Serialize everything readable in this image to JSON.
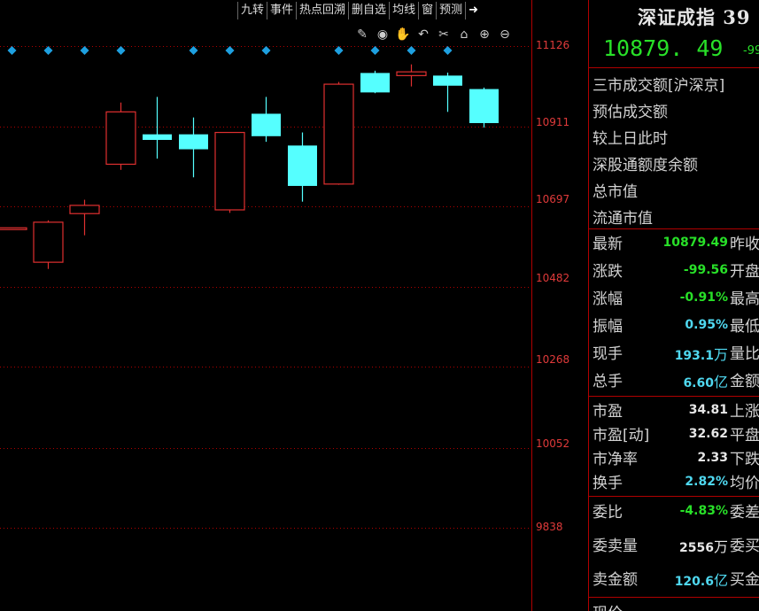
{
  "toolbar": {
    "items": [
      "九转",
      "事件",
      "热点回溯",
      "删自选",
      "均线",
      "窗",
      "预测"
    ],
    "pin_icon": "pin-right-icon"
  },
  "tools": [
    "pencil-icon",
    "eye-icon",
    "hand-icon",
    "undo-icon",
    "scissors-icon",
    "lock-icon",
    "zoom-in-icon",
    "zoom-out-icon"
  ],
  "colors": {
    "up": "#e03030",
    "down": "#55ffff",
    "marker": "#1ea0e0",
    "grid": "#b00000"
  },
  "price_axis": {
    "ticks": [
      "11126",
      "10911",
      "10697",
      "10482",
      "10268",
      "10052",
      "9838"
    ]
  },
  "chart_data": {
    "type": "candlestick",
    "ylim": [
      9838,
      11126
    ],
    "candles": [
      {
        "o": 10640,
        "c": 10640,
        "h": 10640,
        "l": 10640
      },
      {
        "o": 10548,
        "c": 10655,
        "h": 10660,
        "l": 10530
      },
      {
        "o": 10678,
        "c": 10700,
        "h": 10715,
        "l": 10620
      },
      {
        "o": 10810,
        "c": 10950,
        "h": 10975,
        "l": 10795
      },
      {
        "o": 10890,
        "c": 10875,
        "h": 10990,
        "l": 10825
      },
      {
        "o": 10890,
        "c": 10850,
        "h": 10935,
        "l": 10775
      },
      {
        "o": 10688,
        "c": 10895,
        "h": 10895,
        "l": 10680
      },
      {
        "o": 10945,
        "c": 10885,
        "h": 10990,
        "l": 10870
      },
      {
        "o": 10860,
        "c": 10752,
        "h": 10895,
        "l": 10710
      },
      {
        "o": 10757,
        "c": 11024,
        "h": 11030,
        "l": 10755
      },
      {
        "o": 11054,
        "c": 11002,
        "h": 11060,
        "l": 11000
      },
      {
        "o": 11047,
        "c": 11057,
        "h": 11077,
        "l": 11018
      },
      {
        "o": 11047,
        "c": 11020,
        "h": 11055,
        "l": 10950
      },
      {
        "o": 11011,
        "c": 10920,
        "h": 11015,
        "l": 10908
      }
    ],
    "markers": [
      0,
      1,
      2,
      3,
      5,
      6,
      7,
      9,
      10,
      11,
      12
    ]
  },
  "panel": {
    "title": "深证成指 39",
    "price": "10879. 49",
    "change": "-99",
    "info_rows": [
      "三市成交额[沪深京]",
      "预估成交额",
      "较上日此时",
      "深股通额度余额",
      "总市值",
      "流通市值"
    ],
    "quotes1": [
      {
        "label": "最新",
        "value": "10879.49",
        "unit": "",
        "color": "green",
        "label2": "昨收"
      },
      {
        "label": "涨跌",
        "value": "-99.56",
        "unit": "",
        "color": "green",
        "label2": "开盘"
      },
      {
        "label": "涨幅",
        "value": "-0.91%",
        "unit": "",
        "color": "green",
        "label2": "最高"
      },
      {
        "label": "振幅",
        "value": "0.95%",
        "unit": "",
        "color": "cyan",
        "label2": "最低"
      },
      {
        "label": "现手",
        "value": "193.1",
        "unit": "万",
        "color": "cyan",
        "label2": "量比"
      },
      {
        "label": "总手",
        "value": "6.60",
        "unit": "亿",
        "color": "cyan",
        "label2": "金额"
      }
    ],
    "quotes2": [
      {
        "label": "市盈",
        "value": "34.81",
        "unit": "",
        "color": "white",
        "label2": "上涨"
      },
      {
        "label": "市盈[动]",
        "value": "32.62",
        "unit": "",
        "color": "white",
        "label2": "平盘"
      },
      {
        "label": "市净率",
        "value": "2.33",
        "unit": "",
        "color": "white",
        "label2": "下跌"
      },
      {
        "label": "换手",
        "value": "2.82%",
        "unit": "",
        "color": "cyan",
        "label2": "均价"
      }
    ],
    "quotes3": [
      {
        "label": "委比",
        "value": "-4.83%",
        "unit": "",
        "color": "green",
        "label2": "委差"
      },
      {
        "label": "委卖量",
        "value": "2556",
        "unit": "万",
        "color": "white",
        "label2": "委买"
      },
      {
        "label": "卖金额",
        "value": "120.6",
        "unit": "亿",
        "color": "cyan",
        "label2": "买金"
      }
    ],
    "footer_label": "现价"
  }
}
